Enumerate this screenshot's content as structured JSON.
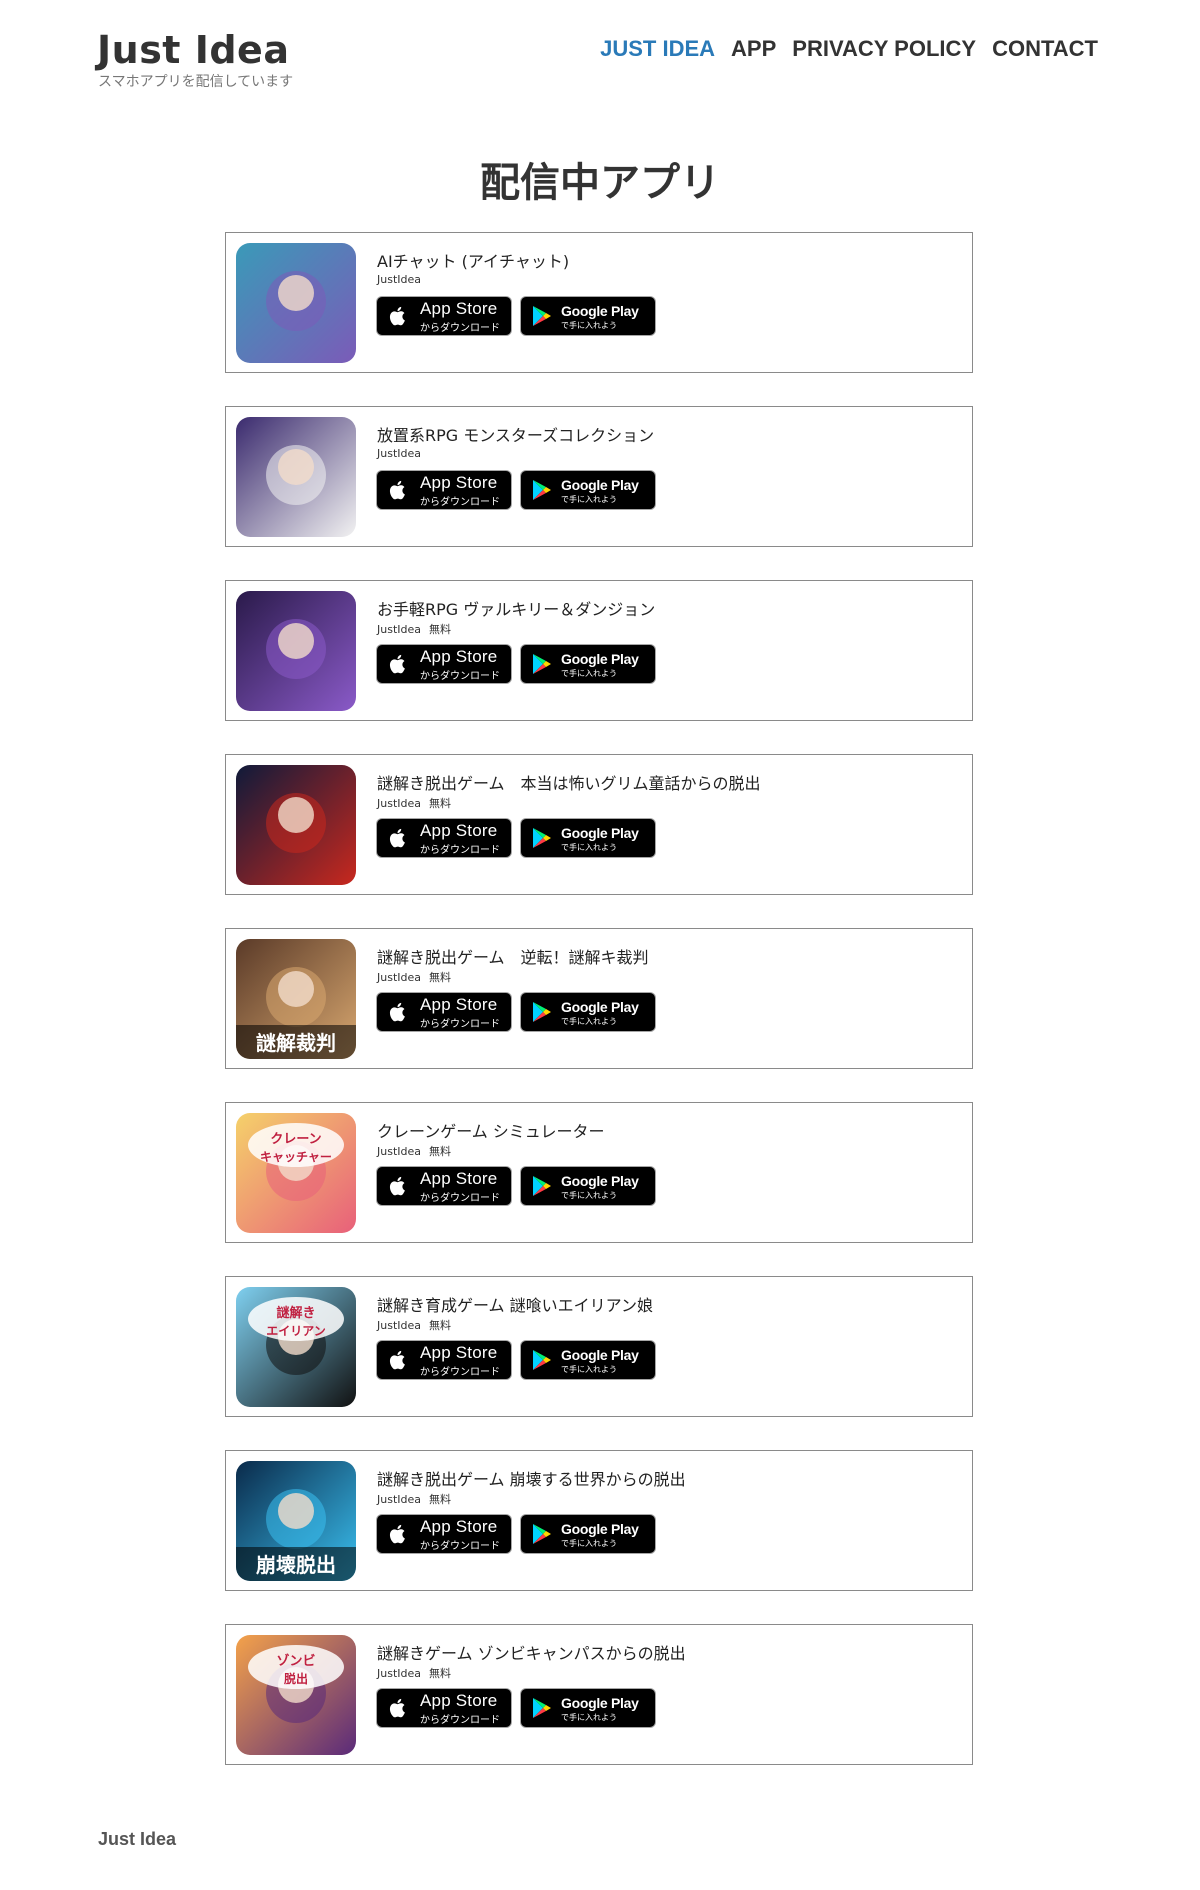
{
  "header": {
    "site_title": "Just Idea",
    "tagline": "スマホアプリを配信しています",
    "nav": [
      "JUST IDEA",
      "APP",
      "PRIVACY POLICY",
      "CONTACT"
    ],
    "active_nav": "JUST IDEA",
    "accent_color": "#2a7ab8"
  },
  "main": {
    "heading": "配信中アプリ",
    "apps": [
      {
        "title": "AIチャット (アイチャット)",
        "developer": "JustIdea",
        "price": "",
        "icon": "ai-chat-girl-icon",
        "icon_colors": [
          "#3a9ab8",
          "#7b5bb8"
        ]
      },
      {
        "title": "放置系RPG モンスターズコレクション",
        "developer": "JustIdea",
        "price": "",
        "icon": "white-bird-monster-icon",
        "icon_colors": [
          "#3a2a6e",
          "#f2f2f2"
        ]
      },
      {
        "title": "お手軽RPG ヴァルキリー＆ダンジョン",
        "developer": "JustIdea",
        "price": "無料",
        "icon": "valkyrie-girl-icon",
        "icon_colors": [
          "#2a1a4a",
          "#8a5ac8"
        ]
      },
      {
        "title": "謎解き脱出ゲーム　本当は怖いグリム童話からの脱出",
        "developer": "JustIdea",
        "price": "無料",
        "icon": "red-hood-icon",
        "icon_colors": [
          "#0f1a3a",
          "#c8281e"
        ]
      },
      {
        "title": "謎解き脱出ゲーム　逆転！謎解キ裁判",
        "developer": "JustIdea",
        "price": "無料",
        "icon": "gavel-icon",
        "icon_colors": [
          "#5a3a28",
          "#d9a870"
        ],
        "icon_text": "謎解裁判"
      },
      {
        "title": "クレーンゲーム シミュレーター",
        "developer": "JustIdea",
        "price": "無料",
        "icon": "crane-catcher-icon",
        "icon_colors": [
          "#f5d16a",
          "#e8607a"
        ],
        "icon_text": "クレーン キャッチャー"
      },
      {
        "title": "謎解き育成ゲーム 謎喰いエイリアン娘",
        "developer": "JustIdea",
        "price": "無料",
        "icon": "alien-girl-icon",
        "icon_colors": [
          "#7fd0f0",
          "#111111"
        ],
        "icon_text": "謎解き エイリアン"
      },
      {
        "title": "謎解き脱出ゲーム 崩壊する世界からの脱出",
        "developer": "JustIdea",
        "price": "無料",
        "icon": "collapse-city-icon",
        "icon_colors": [
          "#0a2a4a",
          "#3ac0f0"
        ],
        "icon_text": "崩壊脱出"
      },
      {
        "title": "謎解きゲーム ゾンビキャンパスからの脱出",
        "developer": "JustIdea",
        "price": "無料",
        "icon": "zombie-girl-icon",
        "icon_colors": [
          "#f4a24a",
          "#5a2a7a"
        ],
        "icon_text": "ゾンビ 脱出"
      }
    ],
    "badges": {
      "app_store": {
        "main": "App Store",
        "sub": "からダウンロード",
        "icon": "apple-icon"
      },
      "google_play": {
        "main": "Google Play",
        "sub": "で手に入れよう",
        "icon": "google-play-icon"
      }
    }
  },
  "footer": {
    "text": "Just Idea"
  }
}
